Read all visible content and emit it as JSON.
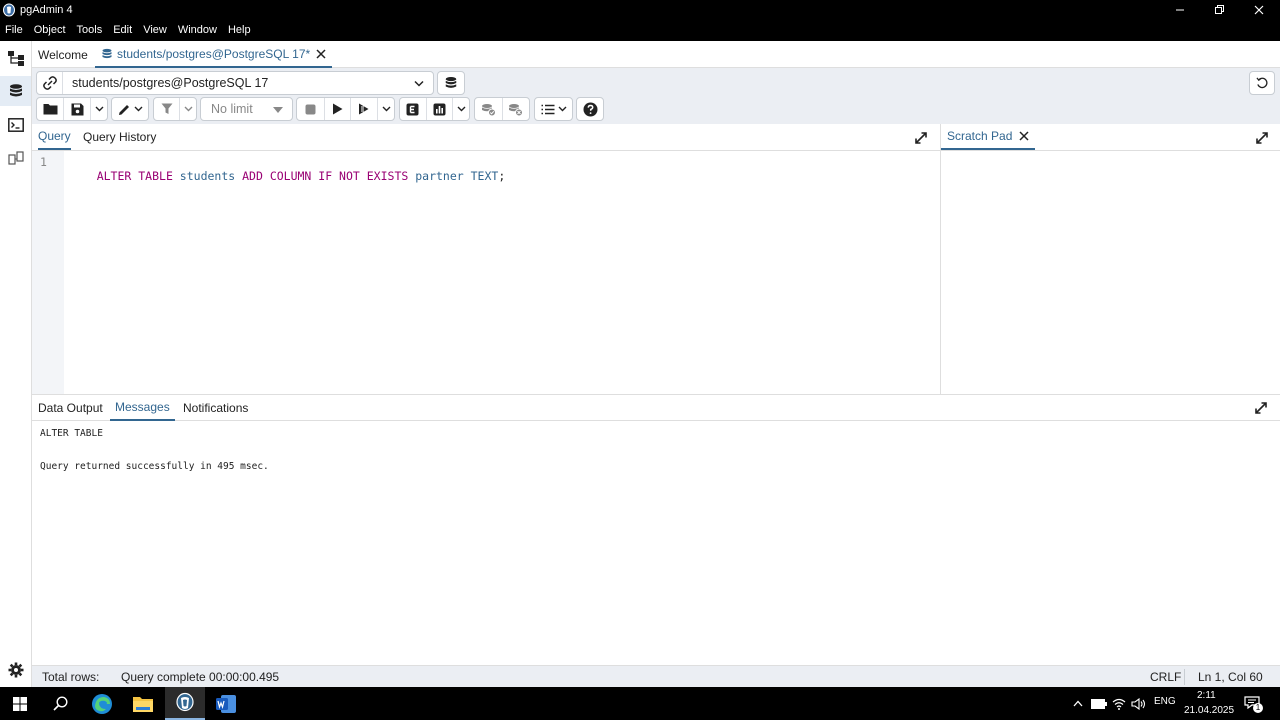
{
  "window": {
    "title": "pgAdmin 4"
  },
  "menu": [
    "File",
    "Object",
    "Tools",
    "Edit",
    "View",
    "Window",
    "Help"
  ],
  "tabs": {
    "welcome": "Welcome",
    "query_tab": "students/postgres@PostgreSQL 17*"
  },
  "connection": {
    "label": "students/postgres@PostgreSQL 17"
  },
  "toolbar": {
    "limit": "No limit"
  },
  "query_panel": {
    "tabs": [
      "Query",
      "Query History"
    ],
    "active": "Query"
  },
  "scratch_pad": {
    "title": "Scratch Pad"
  },
  "editor": {
    "line_number": "1",
    "tokens": [
      {
        "text": "ALTER TABLE",
        "color": "#990073"
      },
      {
        "text": " students ",
        "color": "#326690"
      },
      {
        "text": "ADD COLUMN IF NOT EXISTS",
        "color": "#990073"
      },
      {
        "text": " partner TEXT",
        "color": "#326690"
      },
      {
        "text": ";",
        "color": "#222222"
      }
    ]
  },
  "output_panel": {
    "tabs": [
      "Data Output",
      "Messages",
      "Notifications"
    ],
    "active": "Messages"
  },
  "messages": [
    "ALTER TABLE",
    "Query returned successfully in 495 msec."
  ],
  "status": {
    "total_rows": "Total rows:",
    "query_status": "Query complete 00:00:00.495",
    "line_ending": "CRLF",
    "cursor": "Ln 1, Col 60"
  },
  "taskbar": {
    "lang": "ENG",
    "time": "2:11",
    "date": "21.04.2025",
    "notification_count": "1"
  },
  "colors": {
    "accent": "#326690",
    "keyword": "#990073",
    "identifier": "#326690"
  }
}
